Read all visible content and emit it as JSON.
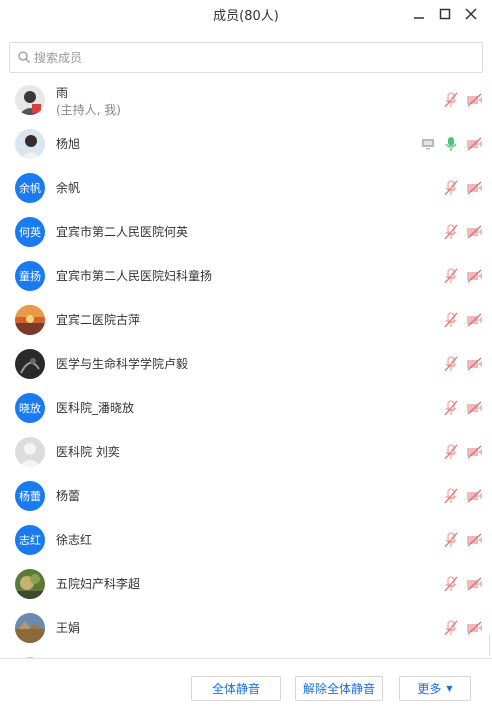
{
  "window": {
    "title": "成员(80人)"
  },
  "search": {
    "placeholder": "搜索成员"
  },
  "members": [
    {
      "name": "雨",
      "role": "(主持人, 我)",
      "avatar": "photo"
    },
    {
      "name": "杨旭",
      "avatar": "photo",
      "share_icon": "screen-share-icon",
      "mic": "active-mic-icon"
    },
    {
      "name": "余帆",
      "initials": "余帆",
      "avatar": "initials"
    },
    {
      "name": "宜宾市第二人民医院何英",
      "initials": "何英",
      "avatar": "initials"
    },
    {
      "name": "宜宾市第二人民医院妇科童扬",
      "initials": "童扬",
      "avatar": "initials"
    },
    {
      "name": "宜宾二医院古萍",
      "avatar": "photo"
    },
    {
      "name": "医学与生命科学学院卢毅",
      "avatar": "photo"
    },
    {
      "name": "医科院_潘晓放",
      "initials": "晓放",
      "avatar": "initials"
    },
    {
      "name": "医科院 刘奕",
      "avatar": "default"
    },
    {
      "name": "杨蕾",
      "initials": "杨蕾",
      "avatar": "initials"
    },
    {
      "name": "徐志红",
      "initials": "志红",
      "avatar": "initials"
    },
    {
      "name": "五院妇产科李超",
      "avatar": "photo"
    },
    {
      "name": "王娟",
      "avatar": "photo"
    }
  ],
  "footer": {
    "mute_all": "全体静音",
    "unmute_all": "解除全体静音",
    "more": "更多"
  },
  "colors": {
    "accent": "#1a7bf0",
    "muted_icon": "#f0a8a8",
    "active_mic": "#4cc47a"
  }
}
